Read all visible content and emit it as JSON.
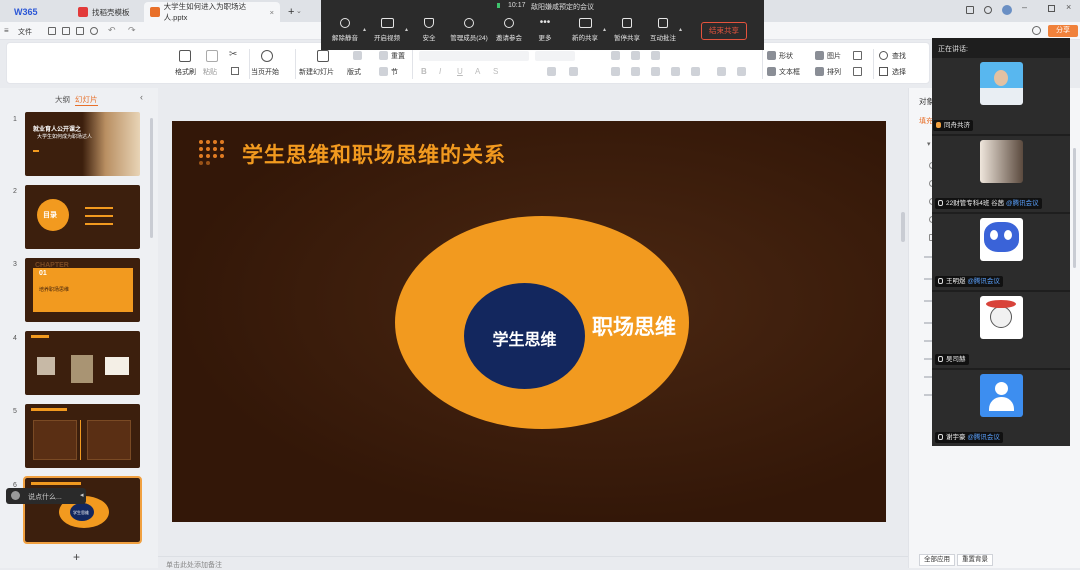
{
  "tabs": {
    "home": "W365",
    "template": "找稻壳模板",
    "document": "大学生如何进入为职场达人.pptx",
    "add": "+"
  },
  "menu": {
    "file": "文件"
  },
  "ribbon": {
    "format_painter": "格式刷",
    "paste": "粘贴",
    "from_current": "当页开始",
    "new_slide": "新建幻灯片",
    "layout": "版式",
    "section": "节",
    "reset": "重置",
    "shape": "形状",
    "image": "图片",
    "textbox": "文本框",
    "arrange": "排列",
    "find": "查找",
    "select": "选择"
  },
  "left_panel": {
    "outline_tab": "大纲",
    "slides_tab": "幻灯片",
    "add_slide": "+",
    "thumbnails": [
      {
        "num": "1",
        "title": "就业育人公开课之",
        "subtitle": "大学生如何成为职场达人"
      },
      {
        "num": "2",
        "title": "目录"
      },
      {
        "num": "3",
        "title": "01",
        "subtitle": "培养职场思维",
        "watermark": "CHAPTER"
      },
      {
        "num": "4",
        "title": ""
      },
      {
        "num": "5",
        "title": ""
      },
      {
        "num": "6",
        "title": "学生思维"
      }
    ]
  },
  "chat_hint": "说点什么...",
  "notes_placeholder": "单击此处添加备注",
  "slide": {
    "title": "学生思维和职场思维的关系",
    "inner_label": "学生思维",
    "outer_label": "职场思维"
  },
  "zoom_toolbar": {
    "time": "10:17",
    "meeting_title": "敌阳嫌咸预定的会议",
    "buttons": {
      "unmute": "解除静音",
      "start_video": "开启视频",
      "security": "安全",
      "participants": "管理成员(24)",
      "invite": "邀请参会",
      "more": "更多",
      "new_share": "新的共享",
      "pause_share": "暂停共享",
      "annotate": "互动批注"
    },
    "end_share": "结束共享"
  },
  "speakers_panel": {
    "header": "正在讲话:",
    "people": [
      {
        "name": "同舟共济",
        "tag": ""
      },
      {
        "name": "22财管专科4班 谷茜",
        "tag": "@腾讯会议"
      },
      {
        "name": "王明煜",
        "tag": "@腾讯会议"
      },
      {
        "name": "吴司赫",
        "tag": ""
      },
      {
        "name": "谢宇豪",
        "tag": "@腾讯会议"
      }
    ]
  },
  "right_panel": {
    "header": "对象",
    "tab": "填充",
    "apply_all": "全部应用",
    "reset_bg": "重置背景"
  },
  "share_button": "分享"
}
